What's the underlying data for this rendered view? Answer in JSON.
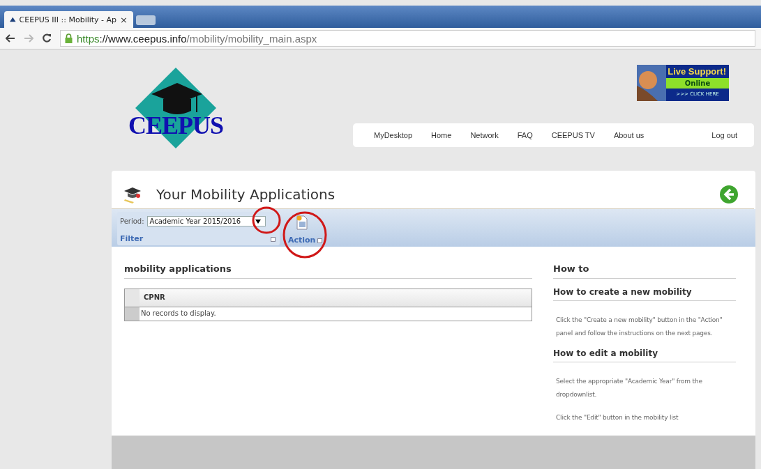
{
  "browser": {
    "tab_title": "CEEPUS III :: Mobility - Ap",
    "tab_close": "×",
    "url": {
      "scheme": "https",
      "host": "://www.ceepus.info",
      "path": "/mobility/mobility_main.aspx"
    }
  },
  "logo": {
    "text": "CEEPUS"
  },
  "live_support": {
    "title": "Live Support!",
    "status": "Online",
    "cta": ">>> CLICK HERE"
  },
  "nav": {
    "items": [
      {
        "label": "MyDesktop"
      },
      {
        "label": "Home"
      },
      {
        "label": "Network"
      },
      {
        "label": "FAQ"
      },
      {
        "label": "CEEPUS TV"
      },
      {
        "label": "About us"
      }
    ],
    "logout": "Log out"
  },
  "page": {
    "title": "Your Mobility Applications"
  },
  "ribbon": {
    "period_label": "Period:",
    "period_value": "Academic Year 2015/2016",
    "filter_label": "Filter",
    "action_label": "Action"
  },
  "list": {
    "heading": "mobility applications",
    "columns": [
      "CPNR"
    ],
    "empty": "No records to display."
  },
  "howto": {
    "heading": "How to",
    "sections": [
      {
        "title": "How to create a new mobility",
        "paragraphs": [
          "Click the \"Create a new mobility\" button in the \"Action\" panel and follow the instructions on the next pages."
        ]
      },
      {
        "title": "How to edit a mobility",
        "paragraphs": [
          "Select the appropriate \"Academic Year\" from the dropdownlist.",
          "Click the \"Edit\" button in the mobility list"
        ]
      }
    ]
  }
}
